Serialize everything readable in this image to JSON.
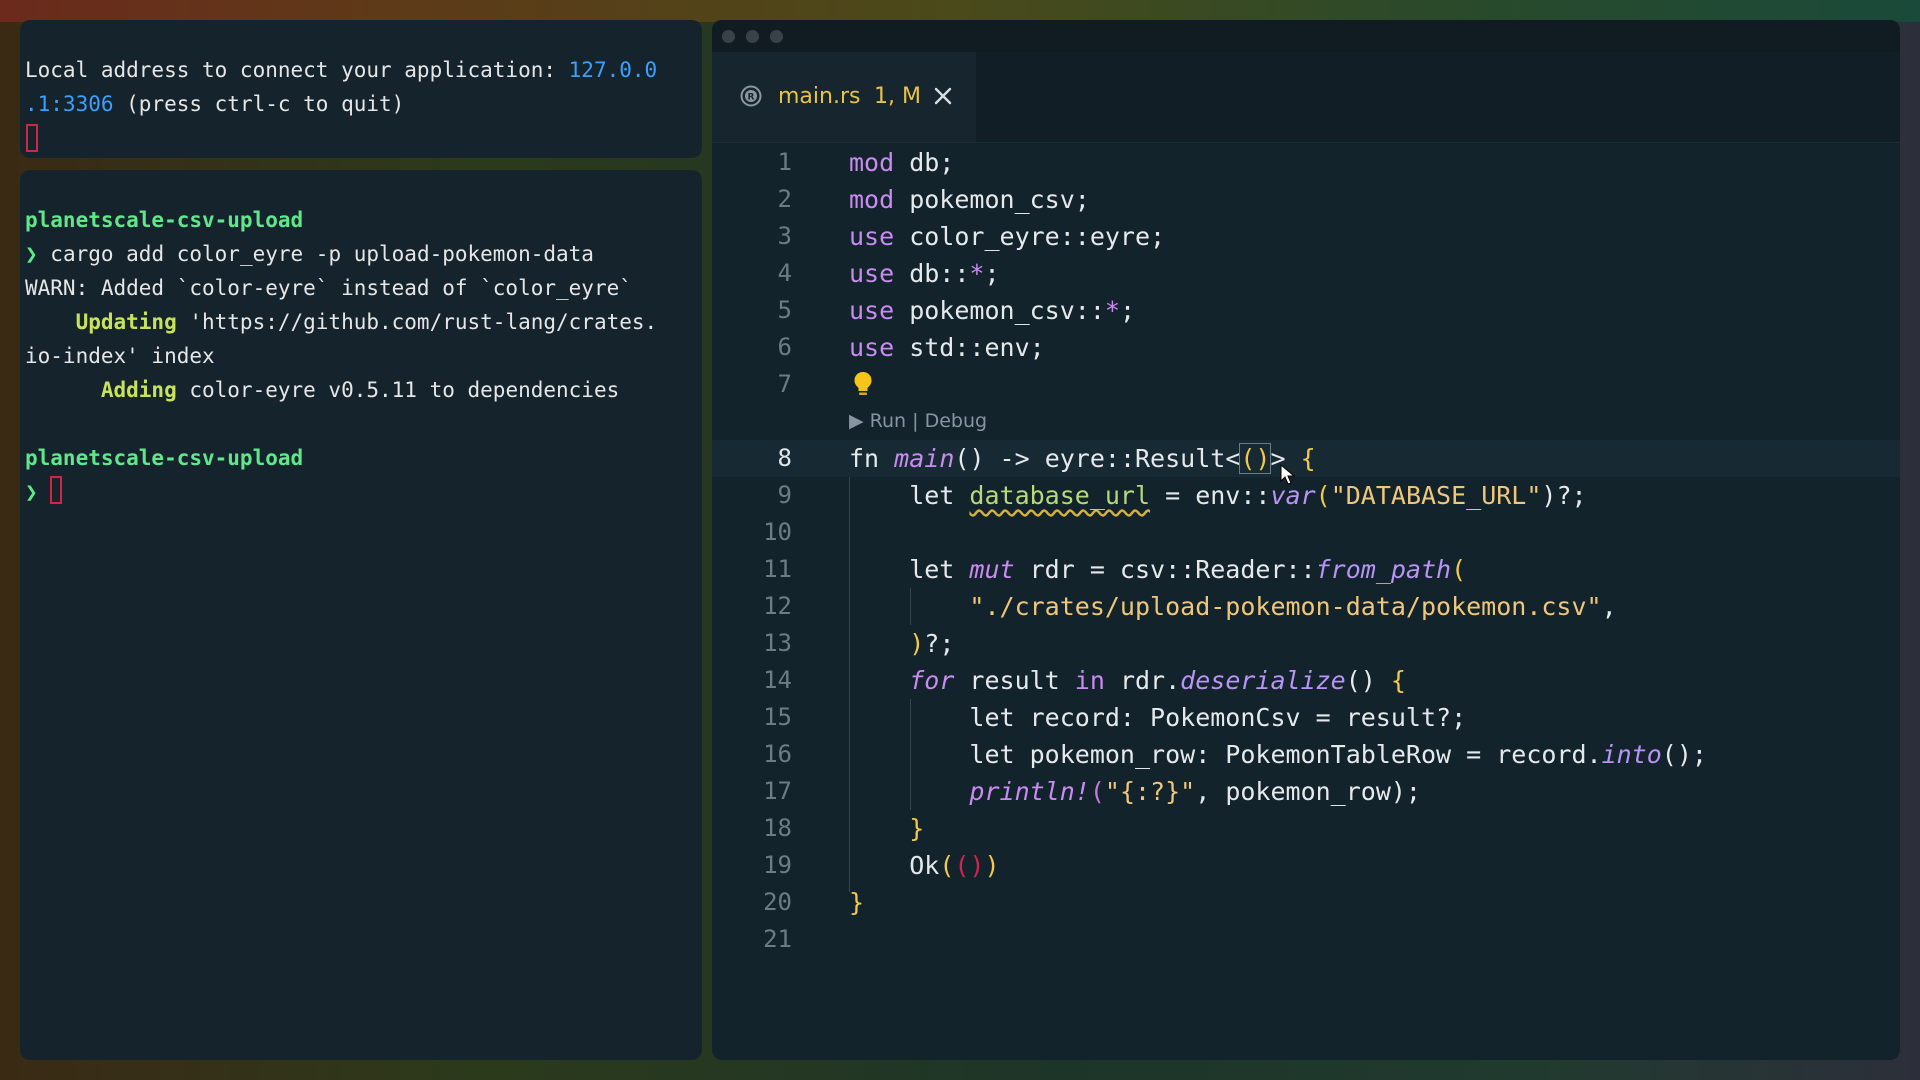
{
  "terminal_top": {
    "line1_prefix": "Local address to connect your application: ",
    "line1_addr": "127.0.0",
    "line2_addr": ".1:3306",
    "line2_suffix": " (press ctrl-c to quit)"
  },
  "terminal_main": {
    "dir1": "planetscale-csv-upload",
    "prompt_symbol": "❯",
    "cmd": " cargo add color_eyre -p upload-pokemon-data",
    "warn": "WARN: Added `color-eyre` instead of `color_eyre`",
    "updating_label": "    Updating",
    "updating_text": " 'https://github.com/rust-lang/crates.",
    "updating_cont": "io-index' index",
    "adding_label": "      Adding",
    "adding_text": " color-eyre v0.5.11 to dependencies",
    "dir2": "planetscale-csv-upload"
  },
  "editor": {
    "tab": {
      "title": "main.rs",
      "status": "1, M",
      "icon": "rust-icon"
    },
    "codelens": "▶ Run | Debug",
    "active_line": 8,
    "lines": [
      {
        "n": "1"
      },
      {
        "n": "2"
      },
      {
        "n": "3"
      },
      {
        "n": "4"
      },
      {
        "n": "5"
      },
      {
        "n": "6"
      },
      {
        "n": "7"
      },
      {
        "n": "8"
      },
      {
        "n": "9"
      },
      {
        "n": "10"
      },
      {
        "n": "11"
      },
      {
        "n": "12"
      },
      {
        "n": "13"
      },
      {
        "n": "14"
      },
      {
        "n": "15"
      },
      {
        "n": "16"
      },
      {
        "n": "17"
      },
      {
        "n": "18"
      },
      {
        "n": "19"
      },
      {
        "n": "20"
      },
      {
        "n": "21"
      }
    ],
    "code": {
      "l1": [
        "mod",
        " db;"
      ],
      "l2": [
        "mod",
        " pokemon_csv;"
      ],
      "l3": [
        "use",
        " color_eyre::eyre;"
      ],
      "l4": [
        "use",
        " db::",
        "*",
        ";"
      ],
      "l5": [
        "use",
        " pokemon_csv::",
        "*",
        ";"
      ],
      "l6": [
        "use",
        " std::env;"
      ],
      "l8": [
        "fn",
        " ",
        "main",
        "() -> eyre::Result<",
        "()",
        "> ",
        "{"
      ],
      "l9": [
        "    let",
        " ",
        "database_url",
        " = env::",
        "var",
        "(",
        "\"DATABASE_URL\"",
        ")?;"
      ],
      "l11": [
        "    let",
        " ",
        "mut",
        " rdr = csv::Reader::",
        "from_path",
        "("
      ],
      "l12": [
        "        ",
        "\"./crates/upload-pokemon-data/pokemon.csv\"",
        ","
      ],
      "l13": [
        "    ",
        ")",
        "?;"
      ],
      "l14": [
        "    ",
        "for",
        " result ",
        "in",
        " rdr.",
        "deserialize",
        "() ",
        "{"
      ],
      "l15": [
        "        let",
        " record: PokemonCsv = result?;"
      ],
      "l16": [
        "        let",
        " pokemon_row: PokemonTableRow = record.",
        "into",
        "();"
      ],
      "l17": [
        "        ",
        "println!",
        "(",
        "\"{:?}\"",
        ", pokemon_row);"
      ],
      "l18": [
        "    ",
        "}"
      ],
      "l19": [
        "    Ok",
        "(",
        "()",
        ")"
      ],
      "l20": [
        "}"
      ]
    }
  },
  "colors": {
    "keyword": "#c98af2",
    "string": "#f0c77a",
    "prompt_green": "#5fe88a",
    "link_blue": "#3aa0ff",
    "tab_modified": "#e8c24a"
  }
}
